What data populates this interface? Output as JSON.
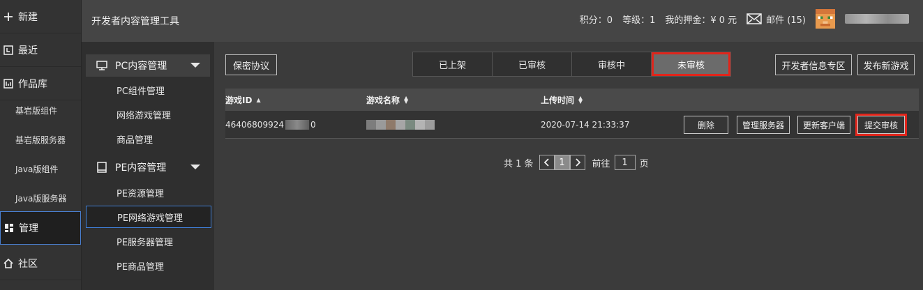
{
  "leftnav": {
    "items": [
      {
        "label": "新建",
        "icon": "plus-icon"
      },
      {
        "label": "最近",
        "icon": "clock-icon"
      },
      {
        "label": "作品库",
        "icon": "library-icon"
      }
    ],
    "subitems": [
      {
        "label": "基岩版组件"
      },
      {
        "label": "基岩版服务器"
      },
      {
        "label": "Java版组件"
      },
      {
        "label": "Java版服务器"
      }
    ],
    "manage": {
      "label": "管理",
      "icon": "dashboard-icon"
    },
    "community": {
      "label": "社区",
      "icon": "home-icon"
    }
  },
  "header": {
    "title": "开发者内容管理工具",
    "points": "积分：0",
    "level": "等级：1",
    "deposit": "我的押金：¥ 0 元",
    "mail": "邮件 (15)"
  },
  "subnav": {
    "pc_group": "PC内容管理",
    "pc_items": [
      "PC组件管理",
      "网络游戏管理",
      "商品管理"
    ],
    "pe_group": "PE内容管理",
    "pe_items": [
      "PE资源管理",
      "PE网络游戏管理",
      "PE服务器管理",
      "PE商品管理"
    ]
  },
  "main": {
    "privacy_button": "保密协议",
    "tabs": [
      "已上架",
      "已审核",
      "审核中",
      "未审核"
    ],
    "dev_info_button": "开发者信息专区",
    "publish_button": "发布新游戏",
    "table": {
      "headers": [
        "游戏ID",
        "游戏名称",
        "上传时间"
      ],
      "row": {
        "id_prefix": "46406809924",
        "id_suffix": "0",
        "upload_time": "2020-07-14 21:33:37",
        "actions": [
          "删除",
          "管理服务器",
          "更新客户端",
          "提交审核"
        ]
      }
    },
    "pager": {
      "total": "共 1 条",
      "page": "1",
      "goto_label": "前往",
      "goto_value": "1",
      "page_suffix": "页"
    }
  },
  "colors": {
    "highlight": "#e0251b",
    "active_border": "#3f7fd8"
  }
}
